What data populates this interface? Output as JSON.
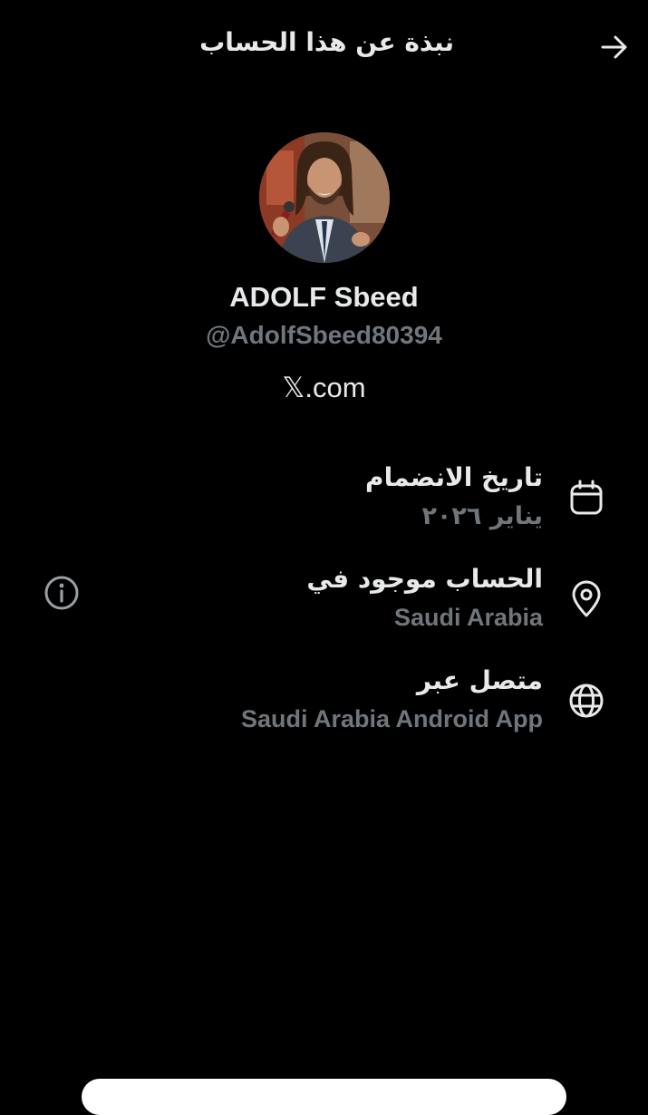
{
  "header": {
    "title": "نبذة عن هذا الحساب",
    "back_icon": "arrow-right-icon"
  },
  "profile": {
    "display_name": "ADOLF Sbeed",
    "handle": "@AdolfSbeed80394",
    "site": "𝕏.com"
  },
  "info": [
    {
      "title": "تاريخ الانضمام",
      "value": "يناير ٢٠٢٦",
      "icon": "calendar-icon"
    },
    {
      "title": "الحساب موجود في",
      "value": "Saudi Arabia",
      "icon": "location-pin-icon",
      "action_icon": "info-icon"
    },
    {
      "title": "متصل عبر",
      "value": "Saudi Arabia Android App",
      "icon": "globe-icon"
    }
  ],
  "colors": {
    "background": "#000000",
    "primary_text": "#e7e9ea",
    "secondary_text": "#71767b"
  }
}
